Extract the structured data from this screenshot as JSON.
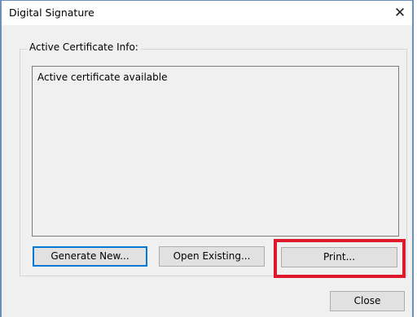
{
  "window": {
    "title": "Digital Signature",
    "close_glyph": "✕"
  },
  "group": {
    "label": "Active Certificate Info:",
    "info_text": "Active certificate available"
  },
  "buttons": {
    "generate_new": "Generate New...",
    "open_existing": "Open Existing...",
    "print": "Print...",
    "close": "Close"
  },
  "annotation": {
    "highlight_color": "#e0182d",
    "highlight_target": "print-button"
  }
}
